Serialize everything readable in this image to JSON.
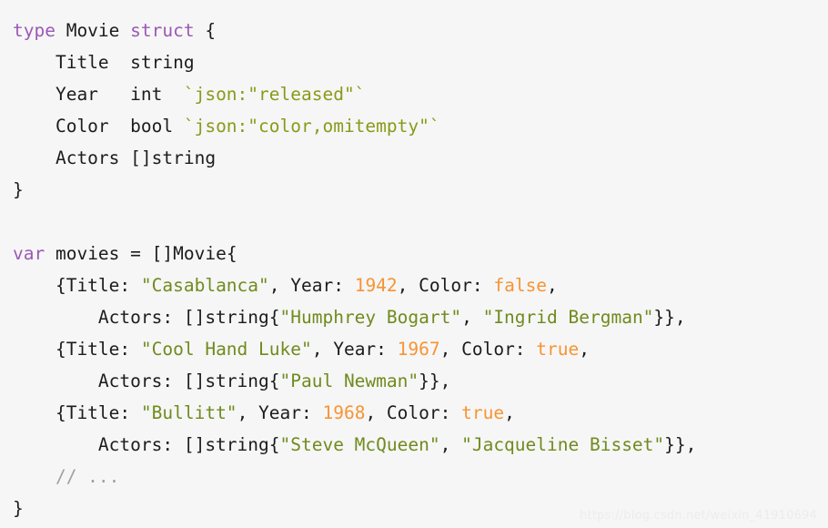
{
  "editor": {
    "language": "go",
    "background_color": "#f6f6f6",
    "text_color": "#1c1c1c",
    "palette": {
      "keyword": "#9b59b6",
      "string": "#6f8b1e",
      "struct_tag": "#8a9a1a",
      "number": "#f79433",
      "boolean": "#f79433",
      "comment": "#9aa0a6",
      "plain": "#1c1c1c"
    }
  },
  "watermark": {
    "text": "https://blog.csdn.net/weixin_41910694"
  },
  "code": {
    "lines": [
      {
        "id": "line-1",
        "tokens": [
          {
            "text": "type ",
            "kind": "kw"
          },
          {
            "text": "Movie ",
            "kind": "plain"
          },
          {
            "text": "struct",
            "kind": "kw"
          },
          {
            "text": " {",
            "kind": "punct"
          }
        ]
      },
      {
        "id": "line-2",
        "tokens": [
          {
            "text": "    Title  string",
            "kind": "plain"
          }
        ]
      },
      {
        "id": "line-3",
        "tokens": [
          {
            "text": "    Year   int  ",
            "kind": "plain"
          },
          {
            "text": "`json:\"released\"`",
            "kind": "tag"
          }
        ]
      },
      {
        "id": "line-4",
        "tokens": [
          {
            "text": "    Color  bool ",
            "kind": "plain"
          },
          {
            "text": "`json:\"color,omitempty\"`",
            "kind": "tag"
          }
        ]
      },
      {
        "id": "line-5",
        "tokens": [
          {
            "text": "    Actors []string",
            "kind": "plain"
          }
        ]
      },
      {
        "id": "line-6",
        "tokens": [
          {
            "text": "}",
            "kind": "punct"
          }
        ]
      },
      {
        "id": "line-7",
        "tokens": [
          {
            "text": "",
            "kind": "plain"
          }
        ]
      },
      {
        "id": "line-8",
        "tokens": [
          {
            "text": "var",
            "kind": "kw"
          },
          {
            "text": " movies = []Movie{",
            "kind": "plain"
          }
        ]
      },
      {
        "id": "line-9",
        "tokens": [
          {
            "text": "    {Title: ",
            "kind": "plain"
          },
          {
            "text": "\"Casablanca\"",
            "kind": "str"
          },
          {
            "text": ", Year: ",
            "kind": "plain"
          },
          {
            "text": "1942",
            "kind": "num"
          },
          {
            "text": ", Color: ",
            "kind": "plain"
          },
          {
            "text": "false",
            "kind": "bool"
          },
          {
            "text": ",",
            "kind": "punct"
          }
        ]
      },
      {
        "id": "line-10",
        "tokens": [
          {
            "text": "        Actors: []string{",
            "kind": "plain"
          },
          {
            "text": "\"Humphrey Bogart\"",
            "kind": "str"
          },
          {
            "text": ", ",
            "kind": "plain"
          },
          {
            "text": "\"Ingrid Bergman\"",
            "kind": "str"
          },
          {
            "text": "}},",
            "kind": "punct"
          }
        ]
      },
      {
        "id": "line-11",
        "tokens": [
          {
            "text": "    {Title: ",
            "kind": "plain"
          },
          {
            "text": "\"Cool Hand Luke\"",
            "kind": "str"
          },
          {
            "text": ", Year: ",
            "kind": "plain"
          },
          {
            "text": "1967",
            "kind": "num"
          },
          {
            "text": ", Color: ",
            "kind": "plain"
          },
          {
            "text": "true",
            "kind": "bool"
          },
          {
            "text": ",",
            "kind": "punct"
          }
        ]
      },
      {
        "id": "line-12",
        "tokens": [
          {
            "text": "        Actors: []string{",
            "kind": "plain"
          },
          {
            "text": "\"Paul Newman\"",
            "kind": "str"
          },
          {
            "text": "}},",
            "kind": "punct"
          }
        ]
      },
      {
        "id": "line-13",
        "tokens": [
          {
            "text": "    {Title: ",
            "kind": "plain"
          },
          {
            "text": "\"Bullitt\"",
            "kind": "str"
          },
          {
            "text": ", Year: ",
            "kind": "plain"
          },
          {
            "text": "1968",
            "kind": "num"
          },
          {
            "text": ", Color: ",
            "kind": "plain"
          },
          {
            "text": "true",
            "kind": "bool"
          },
          {
            "text": ",",
            "kind": "punct"
          }
        ]
      },
      {
        "id": "line-14",
        "tokens": [
          {
            "text": "        Actors: []string{",
            "kind": "plain"
          },
          {
            "text": "\"Steve McQueen\"",
            "kind": "str"
          },
          {
            "text": ", ",
            "kind": "plain"
          },
          {
            "text": "\"Jacqueline Bisset\"",
            "kind": "str"
          },
          {
            "text": "}},",
            "kind": "punct"
          }
        ]
      },
      {
        "id": "line-15",
        "tokens": [
          {
            "text": "    // ...",
            "kind": "comment"
          }
        ]
      },
      {
        "id": "line-16",
        "tokens": [
          {
            "text": "}",
            "kind": "punct"
          }
        ]
      }
    ]
  }
}
